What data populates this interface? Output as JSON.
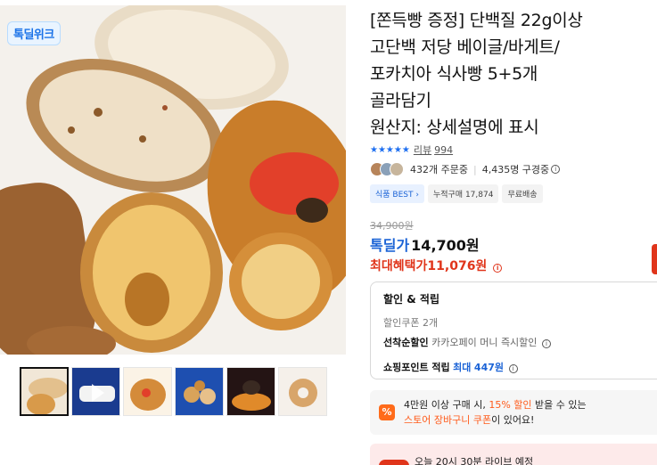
{
  "product": {
    "title_lines": [
      "[쫀득빵 증정] 단백질 22g이상",
      "고단백 저당 베이글/바게트/",
      "포카치아 식사빵 5+5개",
      "골라담기",
      "원산지: 상세설명에 표시"
    ],
    "badge": "톡딜위크",
    "rating": {
      "stars": "★★★★★",
      "review_label": "리뷰",
      "review_count": "994"
    },
    "buyers": {
      "ordering": "432개 주문중",
      "watching": "4,435명 구경중"
    },
    "tags": [
      "식품 BEST",
      "누적구매 17,874",
      "무료배송"
    ],
    "price": {
      "original": "34,900원",
      "deal_label": "톡딜가",
      "deal_price": "14,700원",
      "max_label": "최대혜택가",
      "max_price": "11,076원"
    }
  },
  "discount": {
    "title": "할인 & 적립",
    "coupon": "할인쿠폰 2개",
    "first_come_label": "선착순할인",
    "first_come_value": "카카오페이 머니 즉시할인",
    "points_label": "쇼핑포인트 적립",
    "points_prefix": "최대",
    "points_value": "447원"
  },
  "store_promo": {
    "icon": "%",
    "line1_a": "4만원 이상 구매 시,",
    "line1_b": "15% 할인",
    "line1_c": "받을 수 있는",
    "line2_a": "스토어 장바구니 쿠폰",
    "line2_b": "이 있어요!"
  },
  "live": {
    "text": "오늘 20시 30분 라이브 예정"
  },
  "colors": {
    "accent_blue": "#1b63d6",
    "accent_red": "#e0351b",
    "accent_orange": "#ff5a1a"
  },
  "icons": [
    "info-circle-icon",
    "star-icon",
    "percent-icon"
  ]
}
